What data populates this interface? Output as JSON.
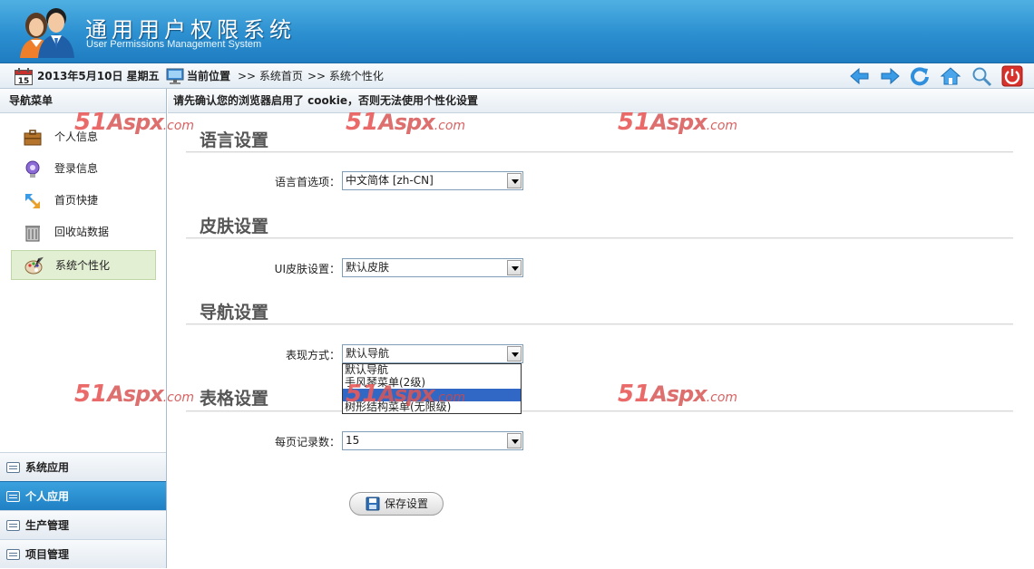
{
  "header": {
    "title": "通用用户权限系统",
    "subtitle": "User Permissions Management System"
  },
  "toolbar": {
    "calendar_day": "15",
    "date": "2013年5月10日 星期五",
    "location_label": "当前位置",
    "crumb1": ">> 系统首页",
    "crumb2": ">> 系统个性化",
    "icons": [
      "back-icon",
      "forward-icon",
      "refresh-icon",
      "home-icon",
      "search-icon",
      "power-icon"
    ]
  },
  "sidebar": {
    "title": "导航菜单",
    "items": [
      {
        "label": "个人信息",
        "icon": "briefcase-icon"
      },
      {
        "label": "登录信息",
        "icon": "bulb-icon"
      },
      {
        "label": "首页快捷",
        "icon": "shortcut-arrows-icon"
      },
      {
        "label": "回收站数据",
        "icon": "recycle-bin-icon"
      },
      {
        "label": "系统个性化",
        "icon": "palette-icon"
      }
    ],
    "sections": [
      {
        "label": "系统应用"
      },
      {
        "label": "个人应用"
      },
      {
        "label": "生产管理"
      },
      {
        "label": "项目管理"
      }
    ]
  },
  "main": {
    "notice": "请先确认您的浏览器启用了 cookie，否则无法使用个性化设置",
    "language": {
      "title": "语言设置",
      "label": "语言首选项：",
      "value": "中文简体 [zh-CN]"
    },
    "skin": {
      "title": "皮肤设置",
      "label": "UI皮肤设置：",
      "value": "默认皮肤"
    },
    "nav": {
      "title": "导航设置",
      "label": "表现方式：",
      "value": "默认导航",
      "options": [
        "默认导航",
        "手风琴菜单(2级)",
        "",
        "树形结构菜单(无限级)"
      ]
    },
    "table": {
      "title": "表格设置",
      "label": "每页记录数：",
      "value": "15"
    },
    "save_label": "保存设置"
  },
  "watermark": {
    "num": "51",
    "brand": "Aspx",
    "domain": ".com"
  },
  "colors": {
    "header_blue": "#2b8fd0",
    "active_section": "#1f80c4",
    "active_item_bg": "#e3efd3",
    "watermark": "#e85a5a"
  }
}
